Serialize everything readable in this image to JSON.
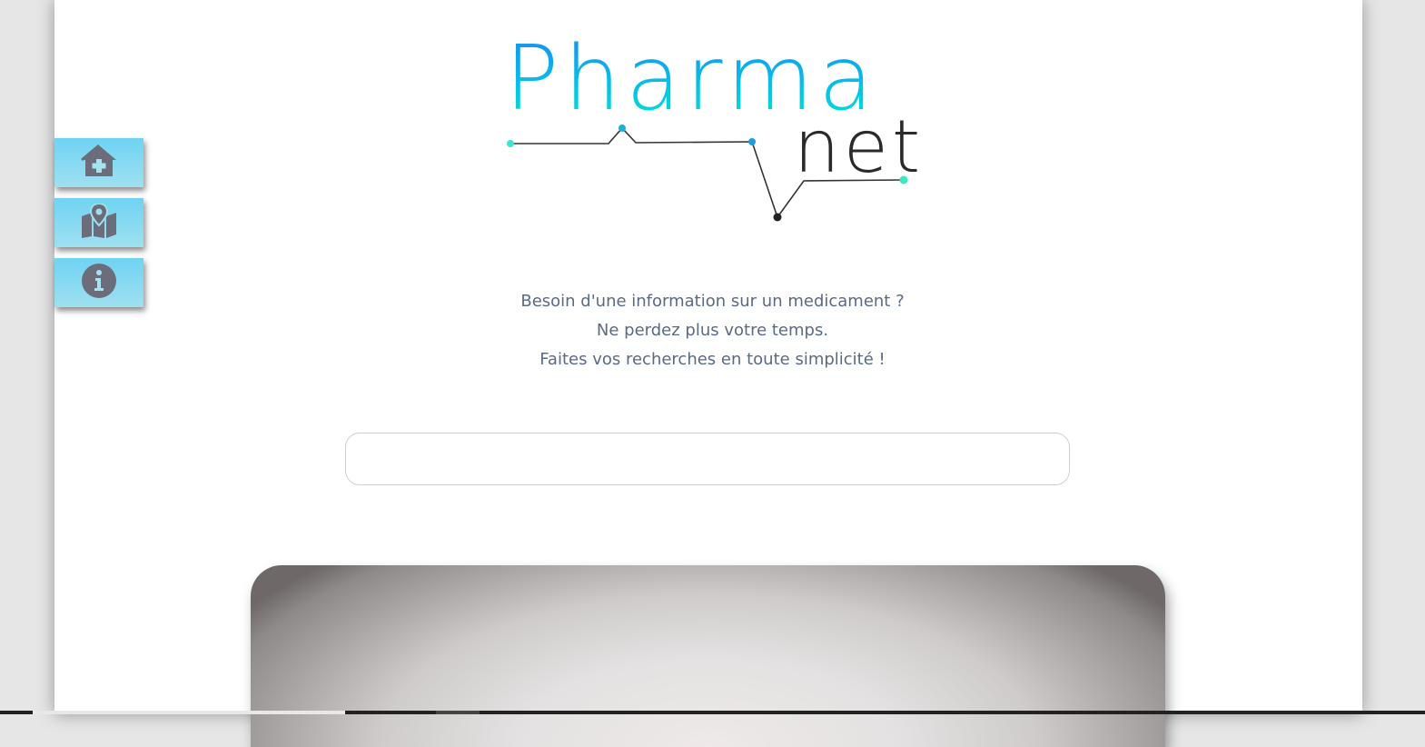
{
  "logo": {
    "word1": "Pharma",
    "word2": "net"
  },
  "nav": {
    "items": [
      {
        "icon": "home-medical-icon"
      },
      {
        "icon": "map-marker-icon"
      },
      {
        "icon": "info-icon"
      }
    ]
  },
  "tagline": {
    "line1": "Besoin d'une information sur un medicament ?",
    "line2": "Ne perdez plus votre temps.",
    "line3": "Faites vos recherches en toute simplicité !"
  },
  "search": {
    "value": "",
    "placeholder": ""
  },
  "colors": {
    "accent": "#05c3e6",
    "nav_button": "#7dd6f2",
    "icon": "#6b6e7a",
    "text": "#5a6a85"
  }
}
